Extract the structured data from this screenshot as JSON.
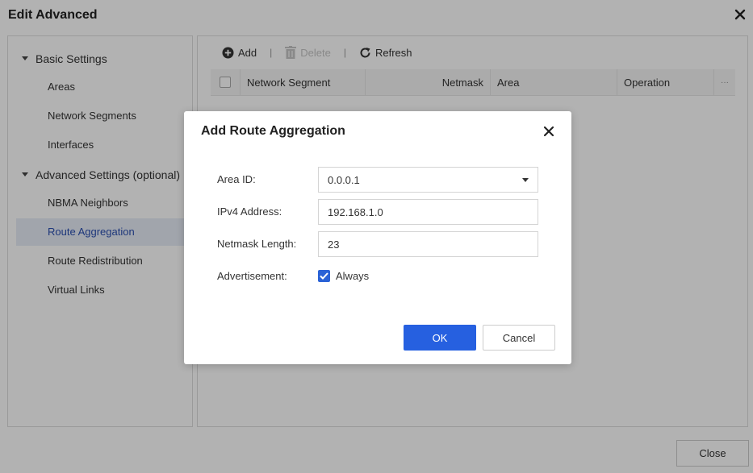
{
  "window": {
    "title": "Edit Advanced",
    "close_label": "Close"
  },
  "sidebar": {
    "groups": [
      {
        "label": "Basic Settings",
        "items": [
          {
            "label": "Areas"
          },
          {
            "label": "Network Segments"
          },
          {
            "label": "Interfaces"
          }
        ]
      },
      {
        "label": "Advanced Settings (optional)",
        "items": [
          {
            "label": "NBMA Neighbors"
          },
          {
            "label": "Route Aggregation",
            "active": true
          },
          {
            "label": "Route Redistribution"
          },
          {
            "label": "Virtual Links"
          }
        ]
      }
    ]
  },
  "toolbar": {
    "add_label": "Add",
    "delete_label": "Delete",
    "refresh_label": "Refresh",
    "separator": "|"
  },
  "table": {
    "columns": [
      "Network Segment",
      "Netmask",
      "Area",
      "Operation"
    ],
    "more_label": "···"
  },
  "dialog": {
    "title": "Add Route Aggregation",
    "fields": {
      "area_id": {
        "label": "Area ID:",
        "value": "0.0.0.1"
      },
      "ipv4_address": {
        "label": "IPv4 Address:",
        "value": "192.168.1.0"
      },
      "netmask_length": {
        "label": "Netmask Length:",
        "value": "23"
      },
      "advertisement": {
        "label": "Advertisement:",
        "option_label": "Always",
        "checked": true
      }
    },
    "ok_label": "OK",
    "cancel_label": "Cancel"
  },
  "colors": {
    "primary": "#2660e0",
    "active_nav_bg": "#e7ecf7",
    "active_nav_text": "#2a4fb0",
    "overlay": "rgba(0,0,0,0.3)"
  },
  "icons": [
    "close-icon",
    "caret-down-icon",
    "add-circle-icon",
    "trash-icon",
    "refresh-icon",
    "dropdown-arrow-icon",
    "checkmark-icon"
  ]
}
